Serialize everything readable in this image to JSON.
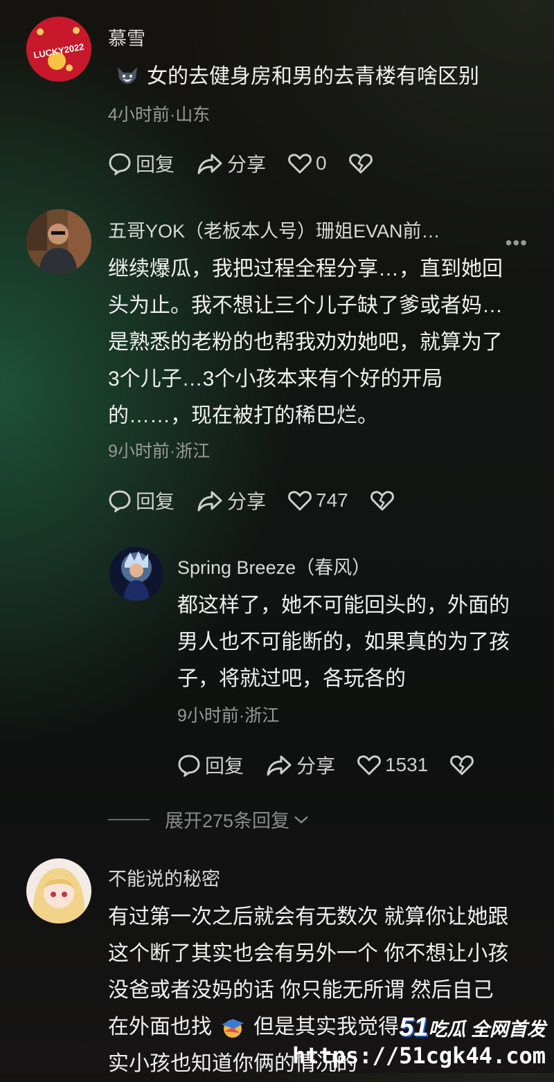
{
  "comments": [
    {
      "username": "慕雪",
      "text": "女的去健身房和男的去青楼有啥区别",
      "meta": "4小时前·山东",
      "reply_label": "回复",
      "share_label": "分享",
      "likes": "0",
      "avatar_text": "LUCKY2022"
    },
    {
      "username": "五哥YOK（老板本人号）珊姐EVAN前…",
      "lines": [
        "继续爆瓜，我把过程全程分享…，直到她回",
        "头为止。我不想让三个儿子缺了爹或者妈…",
        "是熟悉的老粉的也帮我劝劝她吧，就算为了",
        "3个儿子…3个小孩本来有个好的开局",
        "的……，现在被打的稀巴烂。"
      ],
      "meta": "9小时前·浙江",
      "reply_label": "回复",
      "share_label": "分享",
      "likes": "747"
    },
    {
      "username": "Spring Breeze（春风）",
      "lines": [
        "都这样了，她不可能回头的，外面的",
        "男人也不可能断的，如果真的为了孩",
        "子，将就过吧，各玩各的"
      ],
      "meta": "9小时前·浙江",
      "reply_label": "回复",
      "share_label": "分享",
      "likes": "1531"
    },
    {
      "username": "不能说的秘密",
      "lines": [
        "有过第一次之后就会有无数次 就算你让她跟",
        "这个断了其实也会有另外一个 你不想让小孩",
        "没爸或者没妈的话 你只能无所谓 然后自己",
        "在外面也找",
        "但是其实我觉得",
        "实小孩也知道你俩的情况的"
      ]
    }
  ],
  "expand_replies": "展开275条回复",
  "watermark": {
    "brand_num": "51",
    "brand_text": "吃瓜 全网首发",
    "url": "https://51cgk44.com"
  },
  "colors": {
    "heart": "#cfcfcf",
    "accent_green": "#205c3e"
  }
}
